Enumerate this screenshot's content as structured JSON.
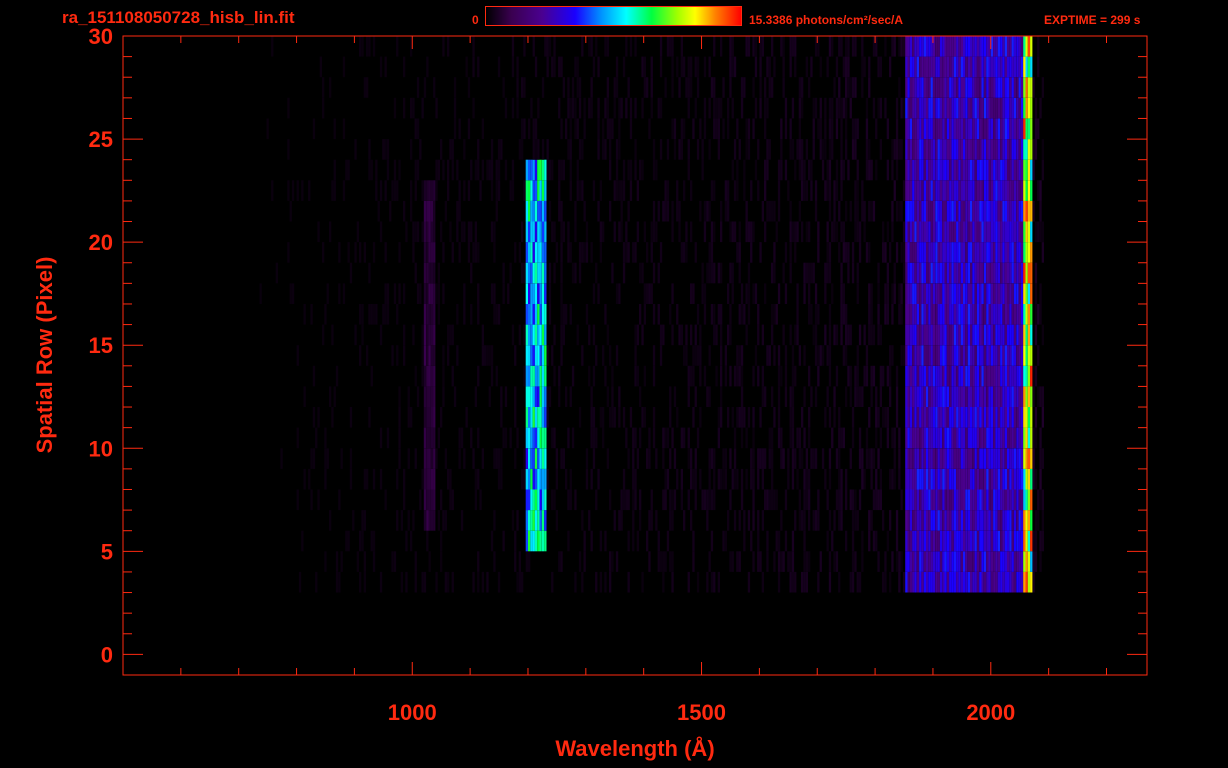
{
  "header": {
    "title": "ra_151108050728_hisb_lin.fit",
    "colorbar_min": "0",
    "colorbar_max": "15.3386 photons/cm²/sec/A",
    "exptime": "EXPTIME = 299 s"
  },
  "colors": {
    "foreground": "#ff2a10",
    "background": "#000000"
  },
  "chart_data": {
    "type": "heatmap",
    "title": "ra_151108050728_hisb_lin.fit",
    "xlabel": "Wavelength (Å)",
    "ylabel": "Spatial Row (Pixel)",
    "xlim": [
      500,
      2270
    ],
    "ylim": [
      -1,
      30
    ],
    "x_ticks": [
      1000,
      1500,
      2000
    ],
    "y_ticks": [
      0,
      5,
      10,
      15,
      20,
      25,
      30
    ],
    "colorbar": {
      "min": 0,
      "max": 15.3386,
      "unit": "photons/cm²/sec/A"
    },
    "colormap": [
      "#000000",
      "#3a0050",
      "#4a0090",
      "#1a00ff",
      "#0090ff",
      "#00ffff",
      "#00ff40",
      "#a0ff00",
      "#ffff00",
      "#ff8000",
      "#ff0000"
    ],
    "emission_features": [
      {
        "x_range": [
          1195,
          1230
        ],
        "y_range": [
          5,
          24
        ],
        "peak_intensity": 9.5
      },
      {
        "x_range": [
          1020,
          1040
        ],
        "y_range": [
          6,
          23
        ],
        "peak_intensity": 1.5
      },
      {
        "x_range": [
          1850,
          2070
        ],
        "y_range": [
          2,
          30
        ],
        "peak_intensity": 5.0
      },
      {
        "x_range": [
          2055,
          2072
        ],
        "y_range": [
          2,
          30
        ],
        "peak_intensity": 15.0
      }
    ],
    "background_region": {
      "x_range": [
        700,
        2090
      ],
      "y_range": [
        3,
        30
      ],
      "mean_intensity": 0.6
    },
    "grid": false,
    "legend": "colorbar-top"
  }
}
